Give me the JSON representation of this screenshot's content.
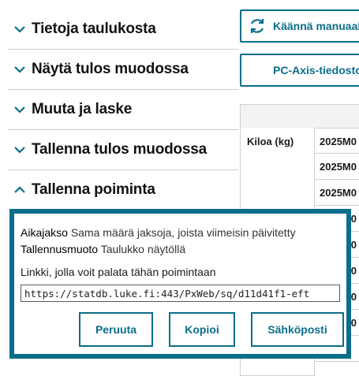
{
  "accordion": {
    "items": [
      {
        "label": "Tietoja taulukosta",
        "state": "collapsed"
      },
      {
        "label": "Näytä tulos muodossa",
        "state": "collapsed"
      },
      {
        "label": "Muuta ja laske",
        "state": "collapsed"
      },
      {
        "label": "Tallenna tulos muodossa",
        "state": "collapsed"
      },
      {
        "label": "Tallenna poiminta",
        "state": "expanded"
      }
    ]
  },
  "toolbar": {
    "translate_label": "Käännä manuaali",
    "pcaxis_label": "PC-Axis-tiedosto"
  },
  "table": {
    "row_label": "Kiloa (kg)",
    "cells": [
      "2025M0",
      "2025M0",
      "2025M0",
      "2025M0",
      "2025M0",
      "2025M0",
      "2025M0",
      "2025M0",
      "2025M"
    ]
  },
  "dialog": {
    "period_key": "Aikajakso",
    "period_value": "Sama määrä jaksoja, joista viimeisin päivitetty",
    "format_key": "Tallennusmuoto",
    "format_value": "Taulukko näytöllä",
    "link_label": "Linkki, jolla voit palata tähän poimintaan",
    "link_value": "https://statdb.luke.fi:443/PxWeb/sq/d11d41f1-eft",
    "cancel_label": "Peruuta",
    "copy_label": "Kopioi",
    "email_label": "Sähköposti"
  },
  "colors": {
    "accent": "#0b6e8a",
    "border": "#cfcfcf"
  }
}
